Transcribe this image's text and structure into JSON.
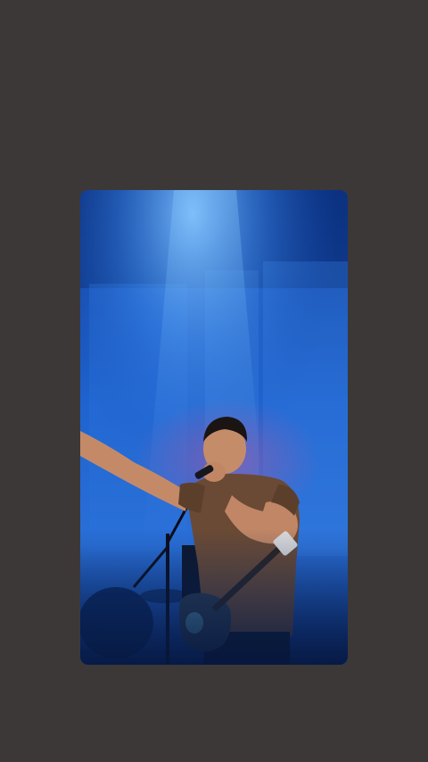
{
  "screen": {
    "background_color": "#3d3838"
  },
  "media": {
    "kind": "photo",
    "colors": {
      "stage_blue": "#1e5fd0",
      "spotlight": "#5fa8ff",
      "deep_blue": "#0b2a66",
      "magenta_haze": "#a54b9a",
      "shirt": "#6a4a34",
      "skin": "#c98f6b",
      "hair": "#1a1512",
      "guitar": "#2b3a4a"
    }
  }
}
